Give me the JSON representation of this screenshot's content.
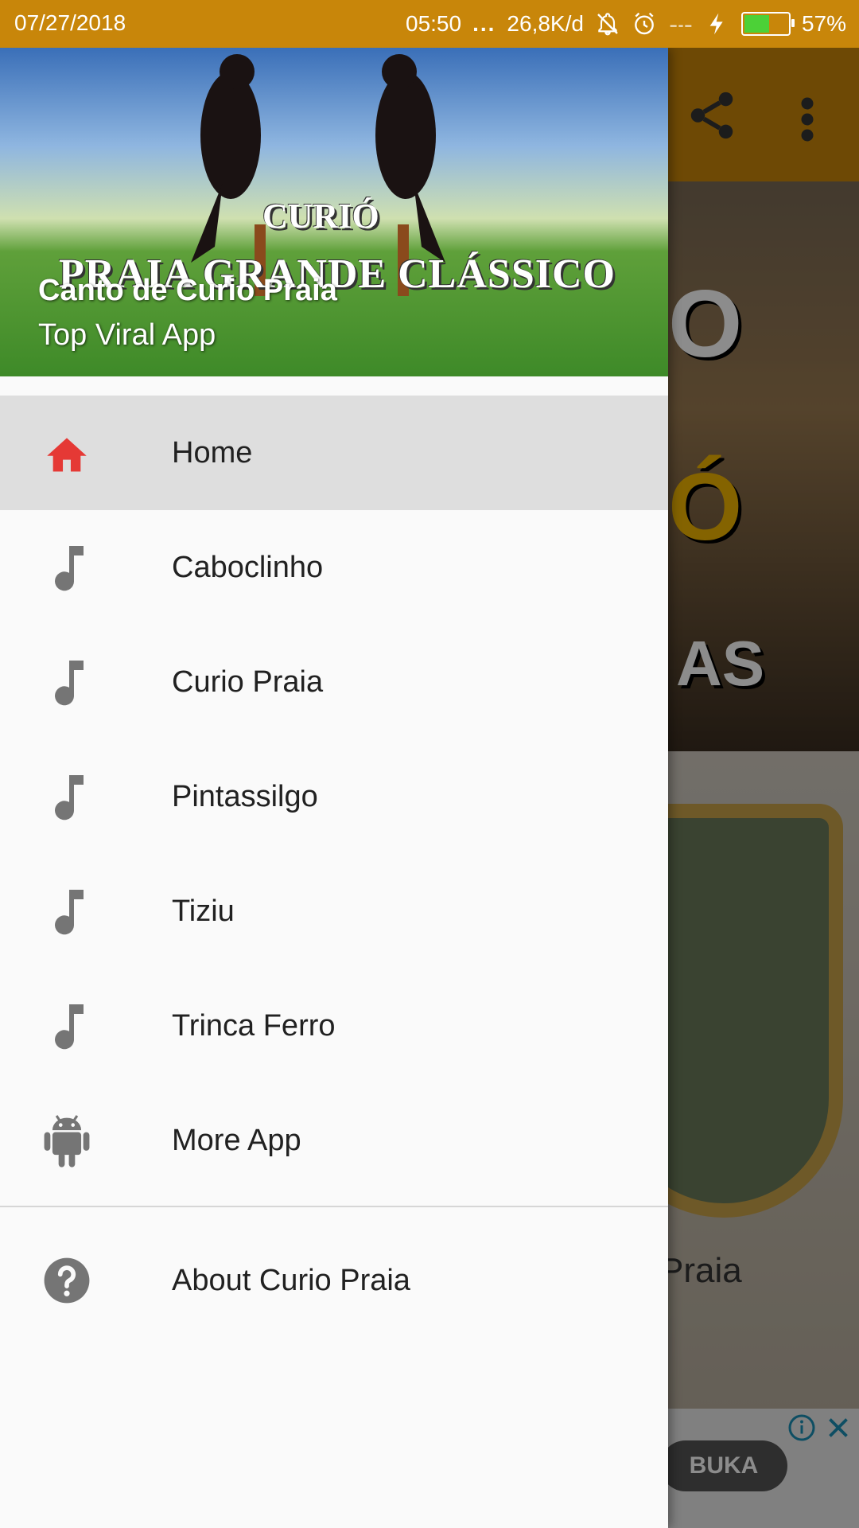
{
  "status_bar": {
    "date": "07/27/2018",
    "time": "05:50",
    "dots": "...",
    "network_speed": "26,8K/d",
    "battery_percent": "57%",
    "battery_level": 0.57,
    "icons": [
      "notifications-off-icon",
      "alarm-icon",
      "signal-icon",
      "charging-icon",
      "battery-icon"
    ]
  },
  "drawer": {
    "header": {
      "logo_text": "CURIÓ",
      "banner_text": "PRAIA GRANDE CLÁSSICO",
      "app_title": "Canto de Curio Praia",
      "subtitle": "Top Viral App"
    },
    "items": [
      {
        "label": "Home",
        "icon": "home-icon",
        "active": true
      },
      {
        "label": "Caboclinho",
        "icon": "music-note-icon"
      },
      {
        "label": "Curio Praia",
        "icon": "music-note-icon"
      },
      {
        "label": "Pintassilgo",
        "icon": "music-note-icon"
      },
      {
        "label": "Tiziu",
        "icon": "music-note-icon"
      },
      {
        "label": "Trinca Ferro",
        "icon": "music-note-icon"
      },
      {
        "label": "More App",
        "icon": "android-icon"
      }
    ],
    "footer_items": [
      {
        "label": "About Curio Praia",
        "icon": "help-icon"
      }
    ]
  },
  "background": {
    "toolbar_icons": [
      "share-icon",
      "more-vert-icon"
    ],
    "card1_text": [
      "O",
      "Ó",
      "AS"
    ],
    "card2_title": "Praia",
    "ad_button": "BUKA",
    "ad_icons": [
      "info-icon",
      "close-icon"
    ]
  },
  "colors": {
    "primary": "#c8860a",
    "home_icon": "#e53935",
    "icon_gray": "#757575",
    "battery_green": "#4cd137"
  }
}
